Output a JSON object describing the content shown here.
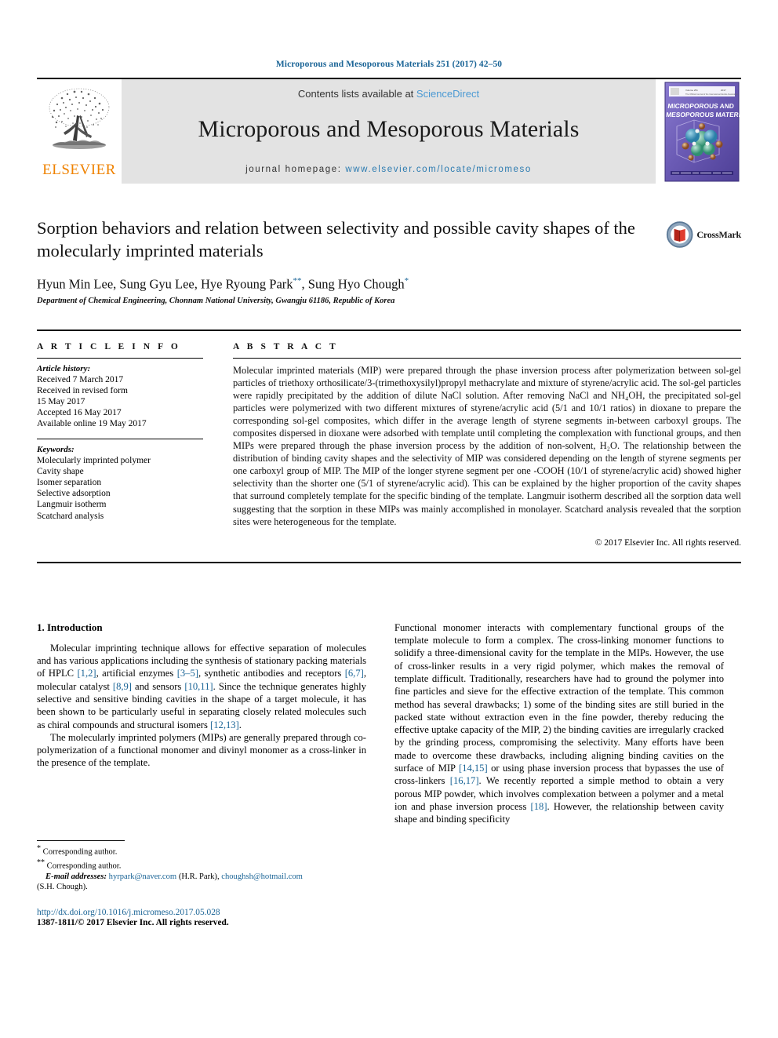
{
  "running_head": "Microporous and Mesoporous Materials 251 (2017) 42–50",
  "masthead": {
    "publisher_name": "ELSEVIER",
    "contents_prefix": "Contents lists available at ",
    "contents_link": "ScienceDirect",
    "journal_title": "Microporous and Mesoporous Materials",
    "homepage_prefix": "journal homepage: ",
    "homepage_url": "www.elsevier.com/locate/micromeso",
    "cover_title_line1": "MICROPOROUS AND",
    "cover_title_line2": "MESOPOROUS MATERIALS"
  },
  "article": {
    "title": "Sorption behaviors and relation between selectivity and possible cavity shapes of the molecularly imprinted materials",
    "authors_part1": "Hyun Min Lee, Sung Gyu Lee, Hye Ryoung Park",
    "authors_mark1": "**",
    "authors_part2": ", Sung Hyo Chough",
    "authors_mark2": "*",
    "affiliation": "Department of Chemical Engineering, Chonnam National University, Gwangju 61186, Republic of Korea",
    "crossmark_label": "CrossMark"
  },
  "article_info": {
    "heading": "A R T I C L E   I N F O",
    "history_label": "Article history:",
    "history": [
      "Received 7 March 2017",
      "Received in revised form",
      "15 May 2017",
      "Accepted 16 May 2017",
      "Available online 19 May 2017"
    ],
    "keywords_label": "Keywords:",
    "keywords": [
      "Molecularly imprinted polymer",
      "Cavity shape",
      "Isomer separation",
      "Selective adsorption",
      "Langmuir isotherm",
      "Scatchard analysis"
    ]
  },
  "abstract": {
    "heading": "A B S T R A C T",
    "text": "Molecular imprinted materials (MIP) were prepared through the phase inversion process after polymerization between sol-gel particles of triethoxy orthosilicate/3-(trimethoxysilyl)propyl methacrylate and mixture of styrene/acrylic acid. The sol-gel particles were rapidly precipitated by the addition of dilute NaCl solution. After removing NaCl and NH₄OH, the precipitated sol-gel particles were polymerized with two different mixtures of styrene/acrylic acid (5/1 and 10/1 ratios) in dioxane to prepare the corresponding sol-gel composites, which differ in the average length of styrene segments in-between carboxyl groups. The composites dispersed in dioxane were adsorbed with template until completing the complexation with functional groups, and then MIPs were prepared through the phase inversion process by the addition of non-solvent, H₂O. The relationship between the distribution of binding cavity shapes and the selectivity of MIP was considered depending on the length of styrene segments per one carboxyl group of MIP. The MIP of the longer styrene segment per one -COOH (10/1 of styrene/acrylic acid) showed higher selectivity than the shorter one (5/1 of styrene/acrylic acid). This can be explained by the higher proportion of the cavity shapes that surround completely template for the specific binding of the template. Langmuir isotherm described all the sorption data well suggesting that the sorption in these MIPs was mainly accomplished in monolayer. Scatchard analysis revealed that the sorption sites were heterogeneous for the template.",
    "copyright": "© 2017 Elsevier Inc. All rights reserved."
  },
  "introduction": {
    "section_number_title": "1.  Introduction",
    "left_paragraph_1": {
      "t1": "Molecular imprinting technique allows for effective separation of molecules and has various applications including the synthesis of stationary packing materials of HPLC ",
      "r1": "[1,2]",
      "t2": ", artificial enzymes ",
      "r2": "[3–5]",
      "t3": ", synthetic antibodies and receptors ",
      "r3": "[6,7]",
      "t4": ", molecular catalyst ",
      "r4": "[8,9]",
      "t5": " and sensors ",
      "r5": "[10,11]",
      "t6": ". Since the technique generates highly selective and sensitive binding cavities in the shape of a target molecule, it has been shown to be particularly useful in separating closely related molecules such as chiral compounds and structural isomers ",
      "r6": "[12,13]",
      "t7": "."
    },
    "left_paragraph_2": "The molecularly imprinted polymers (MIPs) are generally prepared through co-polymerization of a functional monomer and divinyl monomer as a cross-linker in the presence of the template.",
    "right_paragraph": {
      "t1": "Functional monomer interacts with complementary functional groups of the template molecule to form a complex. The cross-linking monomer functions to solidify a three-dimensional cavity for the template in the MIPs. However, the use of cross-linker results in a very rigid polymer, which makes the removal of template difficult. Traditionally, researchers have had to ground the polymer into fine particles and sieve for the effective extraction of the template. This common method has several drawbacks; 1) some of the binding sites are still buried in the packed state without extraction even in the fine powder, thereby reducing the effective uptake capacity of the MIP, 2) the binding cavities are irregularly cracked by the grinding process, compromising the selectivity. Many efforts have been made to overcome these drawbacks, including aligning binding cavities on the surface of MIP ",
      "r1": "[14,15]",
      "t2": " or using phase inversion process that bypasses the use of cross-linkers ",
      "r2": "[16,17]",
      "t3": ". We recently reported a simple method to obtain a very porous MIP powder, which involves complexation between a polymer and a metal ion and phase inversion process ",
      "r3": "[18]",
      "t4": ". However, the relationship between cavity shape and binding specificity"
    }
  },
  "footnotes": {
    "mark_single": "*",
    "mark_double": "**",
    "corresponding_1": " Corresponding author.",
    "corresponding_2": " Corresponding author.",
    "email_label": "E-mail addresses:",
    "email_1": "hyrpark@naver.com",
    "email_1_person": " (H.R. Park), ",
    "email_2": "choughsh@hotmail.com",
    "email_2_person": "(S.H. Chough).",
    "doi": "http://dx.doi.org/10.1016/j.micromeso.2017.05.028",
    "issn": "1387-1811/© 2017 Elsevier Inc. All rights reserved."
  },
  "colors": {
    "link_blue": "#1a6496",
    "sciencedirect_blue": "#4a99d3",
    "elsevier_orange": "#ef8200",
    "masthead_grey": "#e3e3e3",
    "cover_purple": "#6b5bb5"
  }
}
